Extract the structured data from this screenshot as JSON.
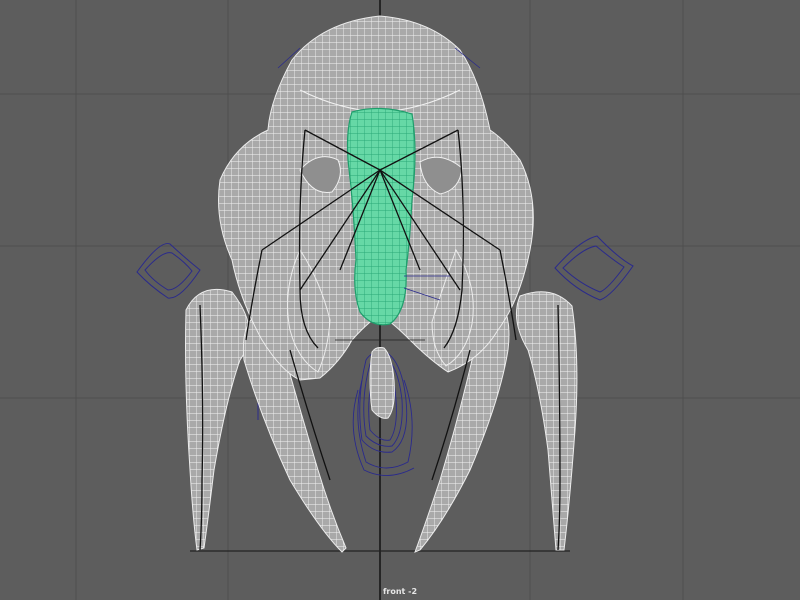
{
  "viewport": {
    "camera_label": "front -2",
    "background": "#5d5d5d",
    "grid_color": "#4f4f4f",
    "axis_color": "#000000",
    "wire_color": "#ffffff",
    "mesh_fill": "#b5b5b5",
    "selection_fill": "#5fd4a0",
    "selection_wire": "#2fb882",
    "curve_color": "#2a2a8c"
  }
}
